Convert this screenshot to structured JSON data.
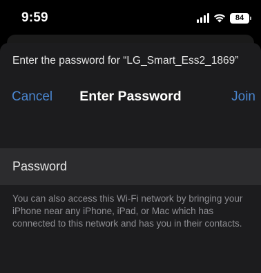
{
  "status_bar": {
    "time": "9:59",
    "signal_icon": "cellular-signal-icon",
    "wifi_icon": "wifi-icon",
    "battery_level": "84"
  },
  "dialog": {
    "prompt": "Enter the password for “LG_Smart_Ess2_1869”",
    "nav": {
      "cancel_label": "Cancel",
      "title": "Enter Password",
      "join_label": "Join"
    },
    "password_field": {
      "placeholder": "Password",
      "value": ""
    },
    "footnote": "You can also access this Wi-Fi network by bringing your iPhone near any iPhone, iPad, or Mac which has connected to this network and has you in their contacts."
  },
  "colors": {
    "accent": "#4a86d0",
    "background": "#000000",
    "sheet": "#1c1c1e",
    "field": "#2c2c2e",
    "secondary_text": "#8e8e93"
  }
}
